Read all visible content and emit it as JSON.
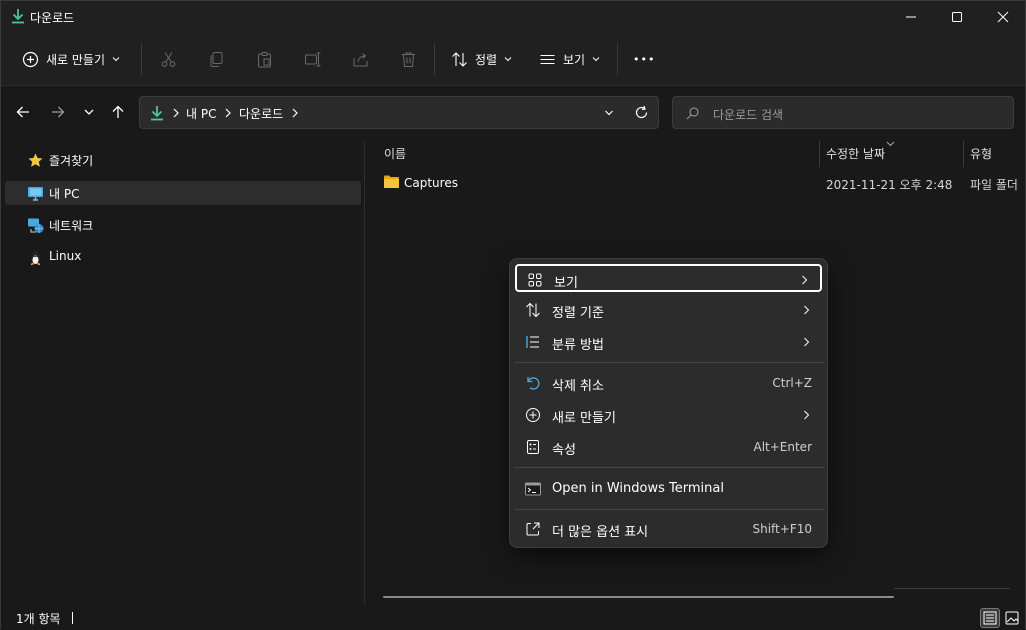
{
  "window": {
    "title": "다운로드"
  },
  "toolbar": {
    "new_label": "새로 만들기",
    "sort_label": "정렬",
    "view_label": "보기",
    "more_label": "•••"
  },
  "address": {
    "crumbs": [
      "내 PC",
      "다운로드"
    ]
  },
  "search": {
    "placeholder": "다운로드 검색"
  },
  "sidebar": {
    "items": [
      {
        "label": "즐겨찾기"
      },
      {
        "label": "내 PC"
      },
      {
        "label": "네트워크"
      },
      {
        "label": "Linux"
      }
    ]
  },
  "list": {
    "columns": [
      "이름",
      "수정한 날짜",
      "유형"
    ],
    "rows": [
      {
        "name": "Captures",
        "modified": "2021-11-21 오후 2:48",
        "type": "파일 폴더"
      }
    ]
  },
  "status": {
    "count": "1개 항목"
  },
  "context_menu": {
    "items": [
      {
        "label": "보기"
      },
      {
        "label": "정렬 기준"
      },
      {
        "label": "분류 방법"
      },
      {
        "label": "삭제 취소",
        "shortcut": "Ctrl+Z"
      },
      {
        "label": "새로 만들기"
      },
      {
        "label": "속성",
        "shortcut": "Alt+Enter"
      },
      {
        "label": "Open in Windows Terminal"
      },
      {
        "label": "더 많은 옵션 표시",
        "shortcut": "Shift+F10"
      }
    ]
  },
  "colors": {
    "accent": "#4cc2a8",
    "folder": "#f5c542",
    "background": "#191919",
    "menu": "#2c2c2c"
  }
}
